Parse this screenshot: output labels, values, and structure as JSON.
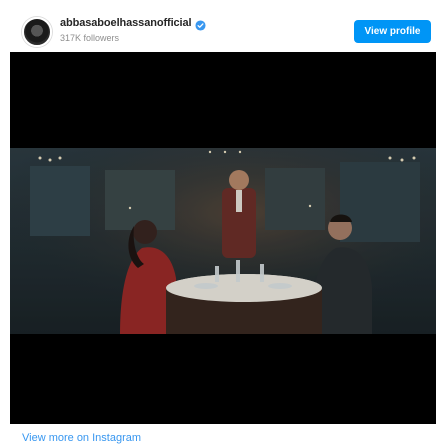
{
  "profile": {
    "username": "abbasaboelhassanofficial",
    "followers": "317K followers",
    "view_profile_label": "View profile",
    "verified_icon": "verified-badge-icon",
    "avatar_icon": "profile-avatar"
  },
  "post": {
    "media_type": "video-frame",
    "view_more_label": "View more on Instagram"
  },
  "colors": {
    "accent": "#0095f6",
    "link": "#3897f0",
    "media_bg": "#000000"
  }
}
